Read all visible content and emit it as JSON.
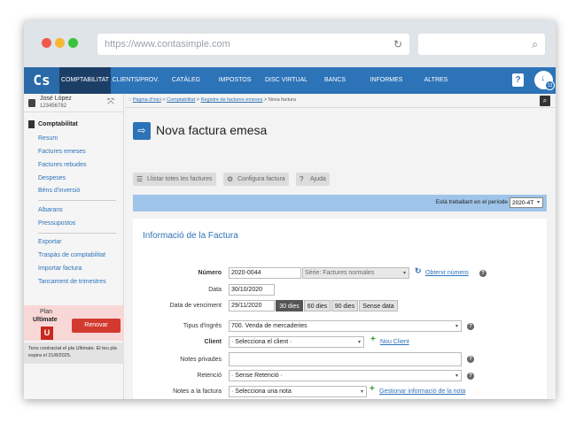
{
  "browser": {
    "url": "https://www.contasimple.com",
    "reload_icon": "reload-icon",
    "search_icon": "search-icon"
  },
  "nav": {
    "logo": "Cs",
    "items": [
      {
        "label": "COMPTABILITAT",
        "active": true
      },
      {
        "label": "CLIENTS/PROV."
      },
      {
        "label": "CATÀLEG"
      },
      {
        "label": "IMPOSTOS"
      },
      {
        "label": "DISC VIRTUAL"
      },
      {
        "label": "BANCS"
      },
      {
        "label": "INFORMES"
      },
      {
        "label": "ALTRES"
      }
    ],
    "help": "?",
    "user_badge": "13"
  },
  "sidebar": {
    "user_name": "José López",
    "user_id": "123456782",
    "section": "Comptabilitat",
    "group1": [
      "Resum",
      "Factures emeses",
      "Factures rebudes",
      "Despeses",
      "Béns d'inversió"
    ],
    "group2": [
      "Albarans",
      "Pressupostos"
    ],
    "group3": [
      "Exportar",
      "Traspàs de comptabilitat",
      "Importar factura",
      "Tancament de trimestres"
    ],
    "plan_label": "Plan",
    "plan_name": "Ultimate",
    "plan_letter": "U",
    "renew": "Renovar",
    "plan_note": "Tens contractat el pla Ultimate. El teu pla expira el 21/8/2025."
  },
  "breadcrumb": {
    "prefix": ":: ",
    "home": "Pàgina d'inici",
    "sep": " > ",
    "l1": "Comptabilitat",
    "l2": "Registre de factures emeses",
    "current": "Nova factura"
  },
  "page": {
    "title": "Nova factura emesa",
    "toolbar": {
      "list": "Llistar totes les factures",
      "config": "Configura factura",
      "help": "Ajuda"
    },
    "period_label": "Està treballant en el període",
    "period_value": "2020-4T"
  },
  "form": {
    "title": "Informació de la Factura",
    "numero_label": "Número",
    "numero_value": "2020-0044",
    "serie": "Sèrie: Factures normales",
    "obtain_link": "Obtenir número",
    "data_label": "Data",
    "data_value": "30/10/2020",
    "venc_label": "Data de venciment",
    "venc_value": "29/11/2020",
    "venc_buttons": [
      "30 dies",
      "60 dies",
      "90 dies",
      "Sense data"
    ],
    "ingres_label": "Tipus d'ingrés",
    "ingres_value": "700. Venda de mercaderies",
    "client_label": "Client",
    "client_value": "· Selecciona el client ·",
    "new_client": "Nou Client",
    "notes_priv_label": "Notes privades",
    "retencio_label": "Retenció",
    "retencio_value": "· Sense Retenció ·",
    "notes_fact_label": "Notes a la factura",
    "notes_fact_value": "· Selecciona una nota",
    "manage_link": "Gestionar informació de la nota"
  }
}
